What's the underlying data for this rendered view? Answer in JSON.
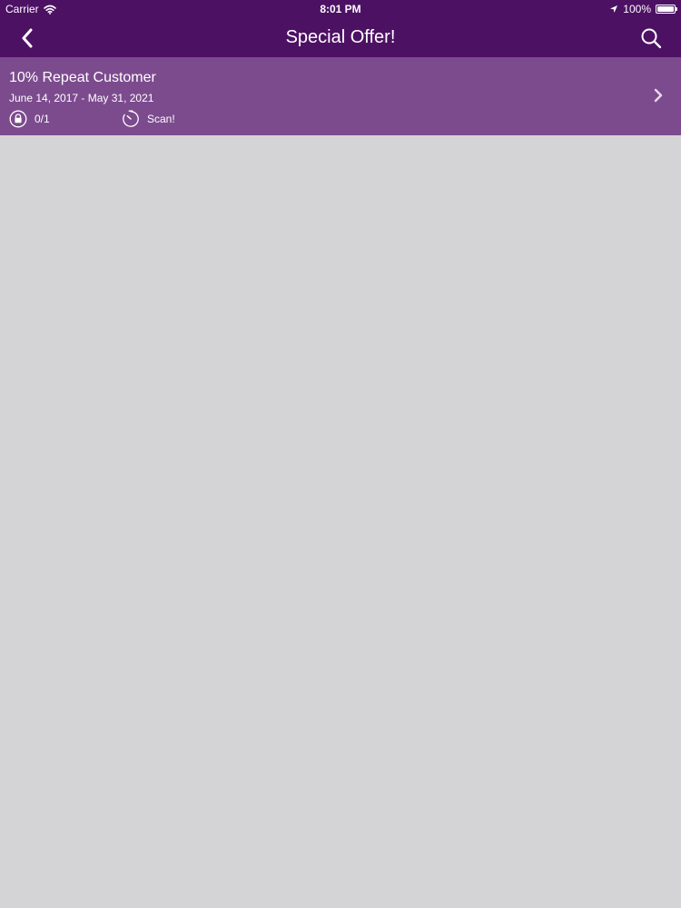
{
  "status_bar": {
    "carrier": "Carrier",
    "time": "8:01 PM",
    "battery_text": "100%",
    "battery_level": 1.0
  },
  "nav": {
    "title": "Special Offer!",
    "back_icon": "chevron-left-icon",
    "search_icon": "search-icon"
  },
  "offer": {
    "title": "10% Repeat Customer",
    "dates": "June 14, 2017 - May 31, 2021",
    "redemptions": "0/1",
    "action": "Scan!",
    "lock_icon": "lock-icon",
    "timer_icon": "timer-icon",
    "chevron_icon": "chevron-right-icon"
  },
  "colors": {
    "header_bg": "#4d1164",
    "offer_bg": "#7c4b8e",
    "page_bg": "#d4d3d5",
    "text": "#ffffff"
  }
}
